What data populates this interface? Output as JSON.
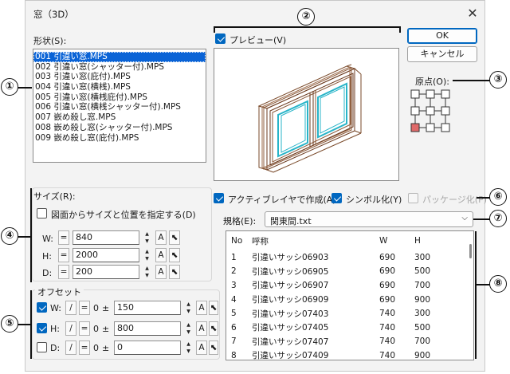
{
  "window": {
    "title": "窓（3D）"
  },
  "shape_section": {
    "label": "形状(S):",
    "items": [
      "001 引違い窓.MPS",
      "002 引違い窓(シャッター付).MPS",
      "003 引違い窓(庇付).MPS",
      "004 引違い窓(横桟).MPS",
      "005 引違い窓(横桟庇付).MPS",
      "006 引違い窓(横桟シャッター付).MPS",
      "007 嵌め殺し窓.MPS",
      "008 嵌め殺し窓(シャッター付).MPS",
      "009 嵌め殺し窓(庇付).MPS"
    ],
    "selected_index": 0
  },
  "preview": {
    "label": "プレビュー(V)",
    "checked": true
  },
  "buttons": {
    "ok": "OK",
    "cancel": "キャンセル"
  },
  "origin": {
    "label": "原点(O):"
  },
  "size": {
    "label": "サイズ(R):",
    "from_drawing_label": "図面からサイズと位置を指定する(D)",
    "from_drawing_checked": false,
    "rows": [
      {
        "axis": "W:",
        "eq": "=",
        "value": "840",
        "a": "A"
      },
      {
        "axis": "H:",
        "eq": "=",
        "value": "2000",
        "a": "A"
      },
      {
        "axis": "D:",
        "eq": "=",
        "value": "200",
        "a": "A"
      }
    ]
  },
  "offset": {
    "label": "オフセット",
    "rows": [
      {
        "axis": "W:",
        "checked": true,
        "div": "/",
        "eq": "=",
        "zero": "0",
        "pm": "±",
        "value": "150",
        "a": "A"
      },
      {
        "axis": "H:",
        "checked": true,
        "div": "/",
        "eq": "=",
        "zero": "0",
        "pm": "±",
        "value": "800",
        "a": "A"
      },
      {
        "axis": "D:",
        "checked": false,
        "div": "/",
        "eq": "=",
        "zero": "0",
        "pm": "±",
        "value": "0",
        "a": "A"
      }
    ]
  },
  "options": {
    "active_layer": "アクティブレイヤで作成(A)",
    "active_layer_checked": true,
    "symbolize": "シンボル化(Y)",
    "symbolize_checked": true,
    "package": "パッケージ化(P)",
    "package_checked": false
  },
  "spec": {
    "label": "規格(E):",
    "selected": "関東間.txt",
    "columns": [
      "No",
      "呼称",
      "W",
      "H"
    ],
    "rows": [
      [
        "1",
        "引違いサッシ06903",
        "690",
        "300"
      ],
      [
        "2",
        "引違いサッシ06905",
        "690",
        "500"
      ],
      [
        "3",
        "引違いサッシ06907",
        "690",
        "700"
      ],
      [
        "4",
        "引違いサッシ06909",
        "690",
        "900"
      ],
      [
        "5",
        "引違いサッシ07403",
        "740",
        "300"
      ],
      [
        "6",
        "引違いサッシ07405",
        "740",
        "500"
      ],
      [
        "7",
        "引違いサッシ07407",
        "740",
        "700"
      ],
      [
        "8",
        "引違いサッシ07409",
        "740",
        "900"
      ]
    ]
  },
  "markers": [
    "①",
    "②",
    "③",
    "④",
    "⑤",
    "⑥",
    "⑦",
    "⑧"
  ],
  "colors": {
    "accent": "#0067c0",
    "selection": "#0a63d6",
    "frame_cyan": "#28b4c8",
    "frame_brown": "#6b3a1e",
    "origin_selected": "#e06a6a"
  }
}
